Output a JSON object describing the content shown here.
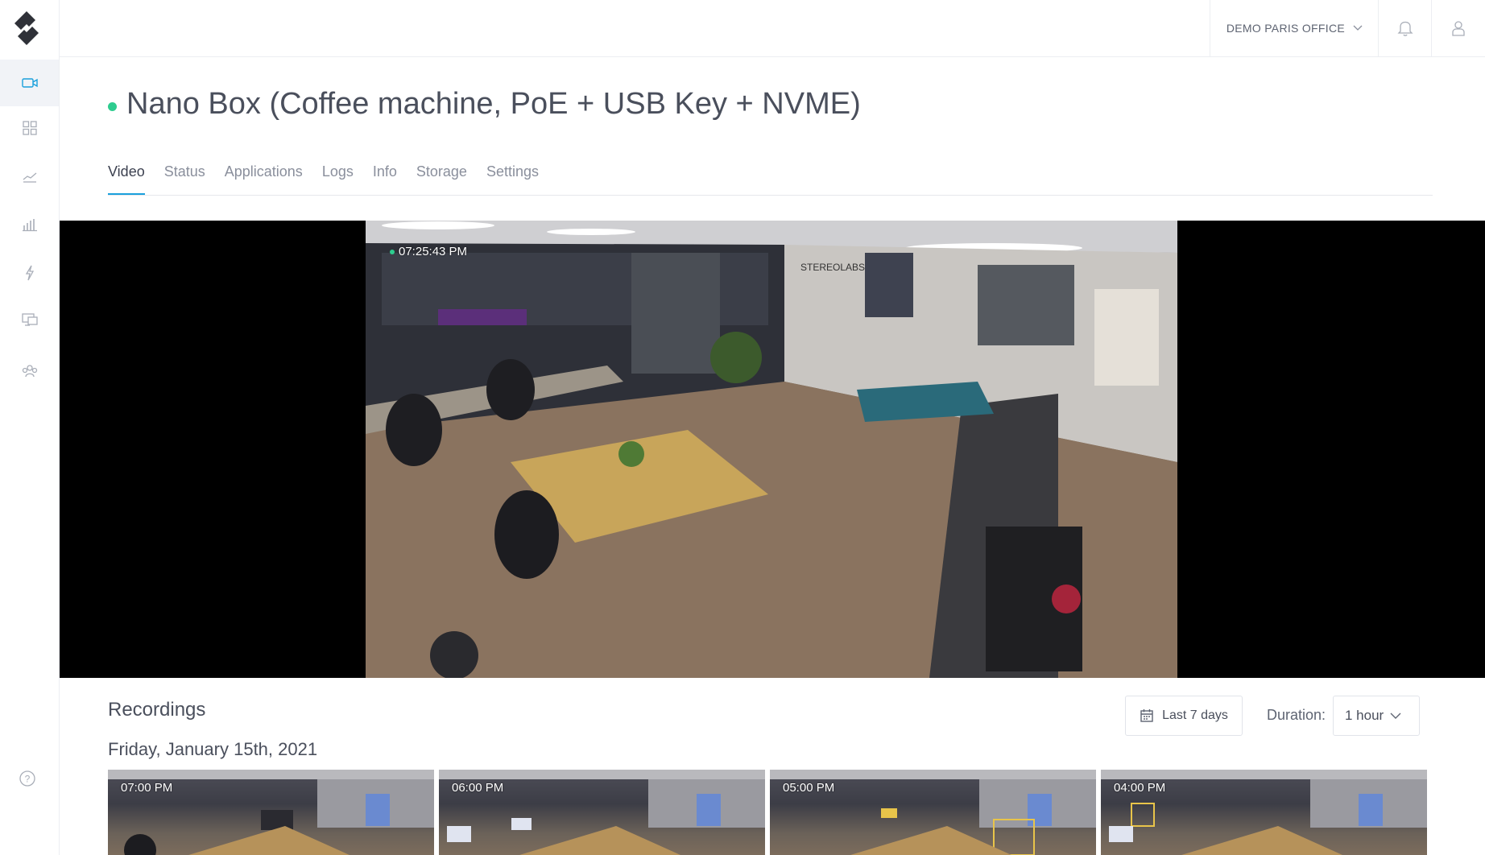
{
  "topbar": {
    "org_name": "DEMO PARIS OFFICE"
  },
  "sidebar": {
    "items": [
      {
        "name": "video-camera-icon",
        "active": true
      },
      {
        "name": "grid-icon",
        "active": false
      },
      {
        "name": "trend-line-icon",
        "active": false
      },
      {
        "name": "bar-chart-icon",
        "active": false
      },
      {
        "name": "lightning-icon",
        "active": false
      },
      {
        "name": "devices-icon",
        "active": false
      },
      {
        "name": "team-icon",
        "active": false
      }
    ],
    "help_icon": "help-icon"
  },
  "device": {
    "title": "Nano Box (Coffee machine, PoE + USB Key + NVME)",
    "status_color": "#2ecc8f"
  },
  "tabs": [
    {
      "label": "Video",
      "active": true
    },
    {
      "label": "Status",
      "active": false
    },
    {
      "label": "Applications",
      "active": false
    },
    {
      "label": "Logs",
      "active": false
    },
    {
      "label": "Info",
      "active": false
    },
    {
      "label": "Storage",
      "active": false
    },
    {
      "label": "Settings",
      "active": false
    }
  ],
  "video": {
    "timestamp": "07:25:43 PM",
    "signage_text": "STEREOLABS"
  },
  "recordings": {
    "title": "Recordings",
    "date_filter": "Last 7 days",
    "duration_label": "Duration:",
    "duration_value": "1 hour",
    "date_heading": "Friday, January 15th, 2021",
    "thumbnails": [
      {
        "time": "07:00 PM"
      },
      {
        "time": "06:00 PM"
      },
      {
        "time": "05:00 PM"
      },
      {
        "time": "04:00 PM"
      }
    ]
  },
  "colors": {
    "accent": "#1aa0dc",
    "online": "#2ecc8f"
  }
}
